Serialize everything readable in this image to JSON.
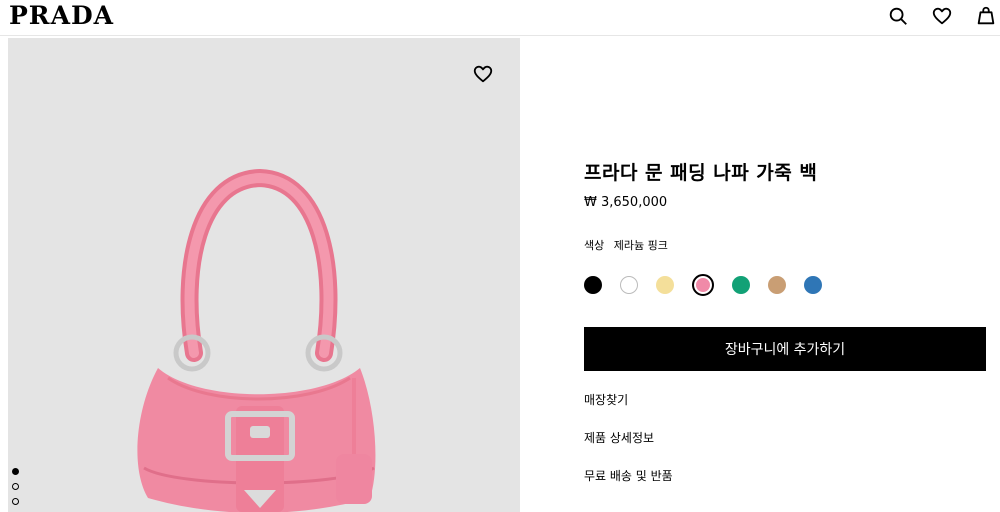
{
  "header": {
    "logo": "PRADA",
    "icons": [
      "search-icon",
      "heart-icon",
      "shopping-bag-icon"
    ]
  },
  "gallery": {
    "favorite_icon": "heart-icon",
    "image": "pink-leather-handbag",
    "pagination": {
      "count": 3,
      "active": 1
    }
  },
  "product": {
    "title": "프라다 문 패딩 나파 가죽 백",
    "price": "₩ 3,650,000",
    "color_label": "색상",
    "color_value": "제라늄 핑크",
    "swatches": [
      {
        "color": "#000000"
      },
      {
        "color": "#ffffff"
      },
      {
        "color": "#f4df9a"
      },
      {
        "color": "#f08aa8",
        "selected": true
      },
      {
        "color": "#12a176"
      },
      {
        "color": "#c99e74"
      },
      {
        "color": "#2f76b6"
      }
    ],
    "add_to_cart": "장바구니에 추가하기",
    "links": [
      "매장찾기",
      "제품 상세정보",
      "무료 배송 및 반품"
    ]
  }
}
